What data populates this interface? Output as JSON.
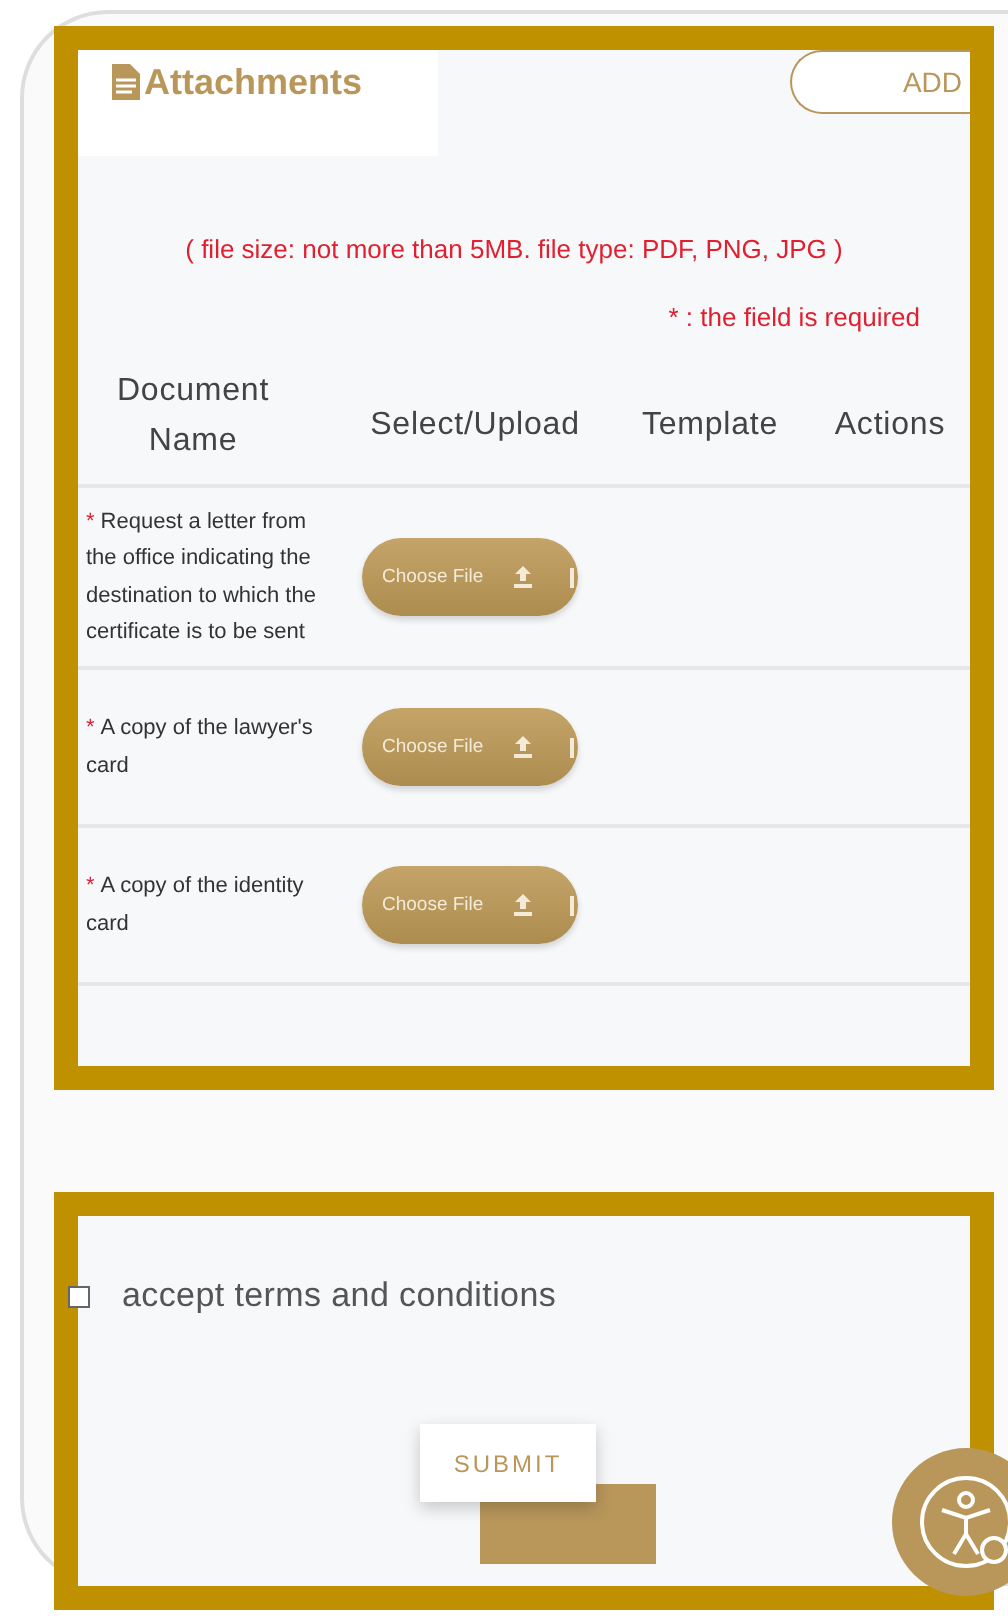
{
  "header": {
    "title": "Attachments",
    "add_button": "ADD"
  },
  "notes": {
    "file_limits": "( file size: not more than 5MB. file type: PDF, PNG, JPG )",
    "required_note": "* : the field is required"
  },
  "table": {
    "columns": [
      "Document Name",
      "Select/Upload",
      "Template",
      "Actions"
    ],
    "rows": [
      {
        "marker": "*",
        "document": "Request a letter from the office indicating the destination to which the certificate is to be sent",
        "upload_button": "Choose File"
      },
      {
        "marker": "*",
        "document": "A copy of the lawyer's card",
        "upload_button": "Choose File"
      },
      {
        "marker": "*",
        "document": "A copy of the identity card",
        "upload_button": "Choose File"
      }
    ]
  },
  "terms": {
    "label": "accept terms and conditions",
    "checked": false
  },
  "submit_button": "SUBMIT"
}
